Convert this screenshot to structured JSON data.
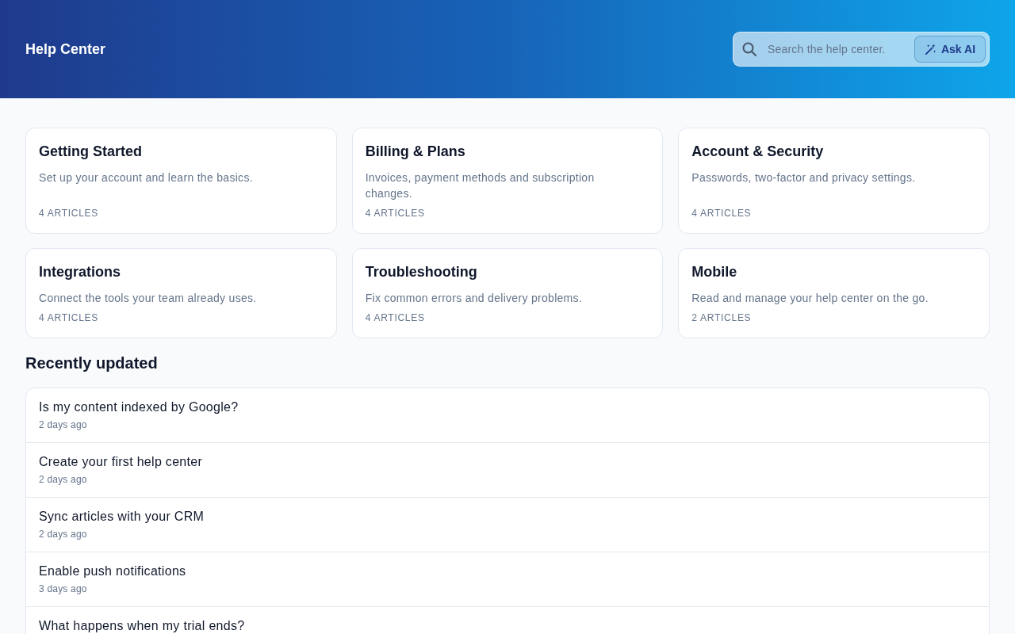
{
  "header": {
    "title": "Help Center",
    "search": {
      "placeholder": "Search the help center."
    },
    "ask_button": "Ask AI"
  },
  "categories": [
    {
      "title": "Getting Started",
      "description": "Set up your account and learn the basics.",
      "count": "4 ARTICLES"
    },
    {
      "title": "Billing & Plans",
      "description": "Invoices, payment methods and subscription changes.",
      "count": "4 ARTICLES"
    },
    {
      "title": "Account & Security",
      "description": "Passwords, two-factor and privacy settings.",
      "count": "4 ARTICLES"
    },
    {
      "title": "Integrations",
      "description": "Connect the tools your team already uses.",
      "count": "4 ARTICLES"
    },
    {
      "title": "Troubleshooting",
      "description": "Fix common errors and delivery problems.",
      "count": "4 ARTICLES"
    },
    {
      "title": "Mobile",
      "description": "Read and manage your help center on the go.",
      "count": "2 ARTICLES"
    }
  ],
  "recent": {
    "heading": "Recently updated",
    "articles": [
      {
        "title": "Is my content indexed by Google?",
        "updated": "2 days ago"
      },
      {
        "title": "Create your first help center",
        "updated": "2 days ago"
      },
      {
        "title": "Sync articles with your CRM",
        "updated": "2 days ago"
      },
      {
        "title": "Enable push notifications",
        "updated": "3 days ago"
      },
      {
        "title": "What happens when my trial ends?"
      }
    ]
  }
}
